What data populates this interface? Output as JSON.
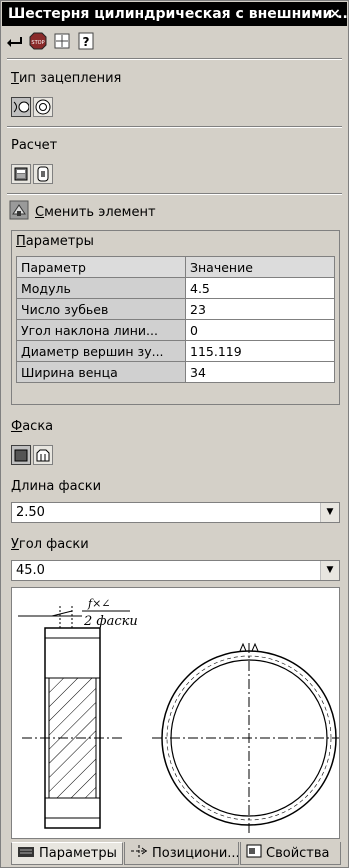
{
  "window": {
    "title": "Шестерня цилиндрическая с внешними ...",
    "close": "×"
  },
  "sections": {
    "mesh_type": {
      "label_u": "Т",
      "label_rest": "ип зацепления"
    },
    "calc": {
      "label": "Расчет"
    },
    "change_element": {
      "label_u": "С",
      "label_rest": "менить элемент"
    },
    "chamfer": {
      "label_u": "Ф",
      "label_rest": "аска"
    },
    "chamfer_length": {
      "label_u": "Д",
      "label_rest": "лина фаски",
      "value": "2.50"
    },
    "chamfer_angle": {
      "label_u": "У",
      "label_rest": "гол фаски",
      "value": "45.0"
    }
  },
  "params": {
    "title_u": "П",
    "title_rest": "араметры",
    "header": [
      "Параметр",
      "Значение"
    ],
    "rows": [
      [
        "Модуль",
        "4.5"
      ],
      [
        "Число зубьев",
        "23"
      ],
      [
        "Угол наклона лини...",
        "0"
      ],
      [
        "Диаметр вершин зу...",
        "115.119"
      ],
      [
        "Ширина венца",
        "34"
      ]
    ]
  },
  "preview": {
    "annot_top": "f×∠",
    "annot_bottom": "2 фаски"
  },
  "tabs": [
    "Параметры",
    "Позициони...",
    "Свойства"
  ]
}
